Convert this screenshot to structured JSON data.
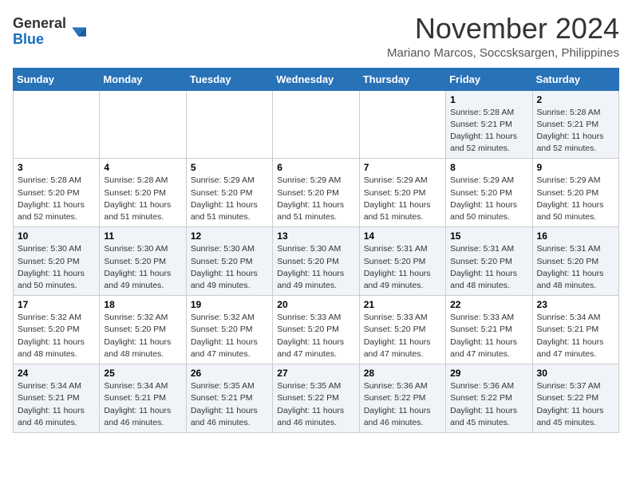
{
  "logo": {
    "general": "General",
    "blue": "Blue"
  },
  "title": "November 2024",
  "location": "Mariano Marcos, Soccsksargen, Philippines",
  "days_of_week": [
    "Sunday",
    "Monday",
    "Tuesday",
    "Wednesday",
    "Thursday",
    "Friday",
    "Saturday"
  ],
  "weeks": [
    [
      {
        "day": "",
        "info": ""
      },
      {
        "day": "",
        "info": ""
      },
      {
        "day": "",
        "info": ""
      },
      {
        "day": "",
        "info": ""
      },
      {
        "day": "",
        "info": ""
      },
      {
        "day": "1",
        "info": "Sunrise: 5:28 AM\nSunset: 5:21 PM\nDaylight: 11 hours\nand 52 minutes."
      },
      {
        "day": "2",
        "info": "Sunrise: 5:28 AM\nSunset: 5:21 PM\nDaylight: 11 hours\nand 52 minutes."
      }
    ],
    [
      {
        "day": "3",
        "info": "Sunrise: 5:28 AM\nSunset: 5:20 PM\nDaylight: 11 hours\nand 52 minutes."
      },
      {
        "day": "4",
        "info": "Sunrise: 5:28 AM\nSunset: 5:20 PM\nDaylight: 11 hours\nand 51 minutes."
      },
      {
        "day": "5",
        "info": "Sunrise: 5:29 AM\nSunset: 5:20 PM\nDaylight: 11 hours\nand 51 minutes."
      },
      {
        "day": "6",
        "info": "Sunrise: 5:29 AM\nSunset: 5:20 PM\nDaylight: 11 hours\nand 51 minutes."
      },
      {
        "day": "7",
        "info": "Sunrise: 5:29 AM\nSunset: 5:20 PM\nDaylight: 11 hours\nand 51 minutes."
      },
      {
        "day": "8",
        "info": "Sunrise: 5:29 AM\nSunset: 5:20 PM\nDaylight: 11 hours\nand 50 minutes."
      },
      {
        "day": "9",
        "info": "Sunrise: 5:29 AM\nSunset: 5:20 PM\nDaylight: 11 hours\nand 50 minutes."
      }
    ],
    [
      {
        "day": "10",
        "info": "Sunrise: 5:30 AM\nSunset: 5:20 PM\nDaylight: 11 hours\nand 50 minutes."
      },
      {
        "day": "11",
        "info": "Sunrise: 5:30 AM\nSunset: 5:20 PM\nDaylight: 11 hours\nand 49 minutes."
      },
      {
        "day": "12",
        "info": "Sunrise: 5:30 AM\nSunset: 5:20 PM\nDaylight: 11 hours\nand 49 minutes."
      },
      {
        "day": "13",
        "info": "Sunrise: 5:30 AM\nSunset: 5:20 PM\nDaylight: 11 hours\nand 49 minutes."
      },
      {
        "day": "14",
        "info": "Sunrise: 5:31 AM\nSunset: 5:20 PM\nDaylight: 11 hours\nand 49 minutes."
      },
      {
        "day": "15",
        "info": "Sunrise: 5:31 AM\nSunset: 5:20 PM\nDaylight: 11 hours\nand 48 minutes."
      },
      {
        "day": "16",
        "info": "Sunrise: 5:31 AM\nSunset: 5:20 PM\nDaylight: 11 hours\nand 48 minutes."
      }
    ],
    [
      {
        "day": "17",
        "info": "Sunrise: 5:32 AM\nSunset: 5:20 PM\nDaylight: 11 hours\nand 48 minutes."
      },
      {
        "day": "18",
        "info": "Sunrise: 5:32 AM\nSunset: 5:20 PM\nDaylight: 11 hours\nand 48 minutes."
      },
      {
        "day": "19",
        "info": "Sunrise: 5:32 AM\nSunset: 5:20 PM\nDaylight: 11 hours\nand 47 minutes."
      },
      {
        "day": "20",
        "info": "Sunrise: 5:33 AM\nSunset: 5:20 PM\nDaylight: 11 hours\nand 47 minutes."
      },
      {
        "day": "21",
        "info": "Sunrise: 5:33 AM\nSunset: 5:20 PM\nDaylight: 11 hours\nand 47 minutes."
      },
      {
        "day": "22",
        "info": "Sunrise: 5:33 AM\nSunset: 5:21 PM\nDaylight: 11 hours\nand 47 minutes."
      },
      {
        "day": "23",
        "info": "Sunrise: 5:34 AM\nSunset: 5:21 PM\nDaylight: 11 hours\nand 47 minutes."
      }
    ],
    [
      {
        "day": "24",
        "info": "Sunrise: 5:34 AM\nSunset: 5:21 PM\nDaylight: 11 hours\nand 46 minutes."
      },
      {
        "day": "25",
        "info": "Sunrise: 5:34 AM\nSunset: 5:21 PM\nDaylight: 11 hours\nand 46 minutes."
      },
      {
        "day": "26",
        "info": "Sunrise: 5:35 AM\nSunset: 5:21 PM\nDaylight: 11 hours\nand 46 minutes."
      },
      {
        "day": "27",
        "info": "Sunrise: 5:35 AM\nSunset: 5:22 PM\nDaylight: 11 hours\nand 46 minutes."
      },
      {
        "day": "28",
        "info": "Sunrise: 5:36 AM\nSunset: 5:22 PM\nDaylight: 11 hours\nand 46 minutes."
      },
      {
        "day": "29",
        "info": "Sunrise: 5:36 AM\nSunset: 5:22 PM\nDaylight: 11 hours\nand 45 minutes."
      },
      {
        "day": "30",
        "info": "Sunrise: 5:37 AM\nSunset: 5:22 PM\nDaylight: 11 hours\nand 45 minutes."
      }
    ]
  ]
}
